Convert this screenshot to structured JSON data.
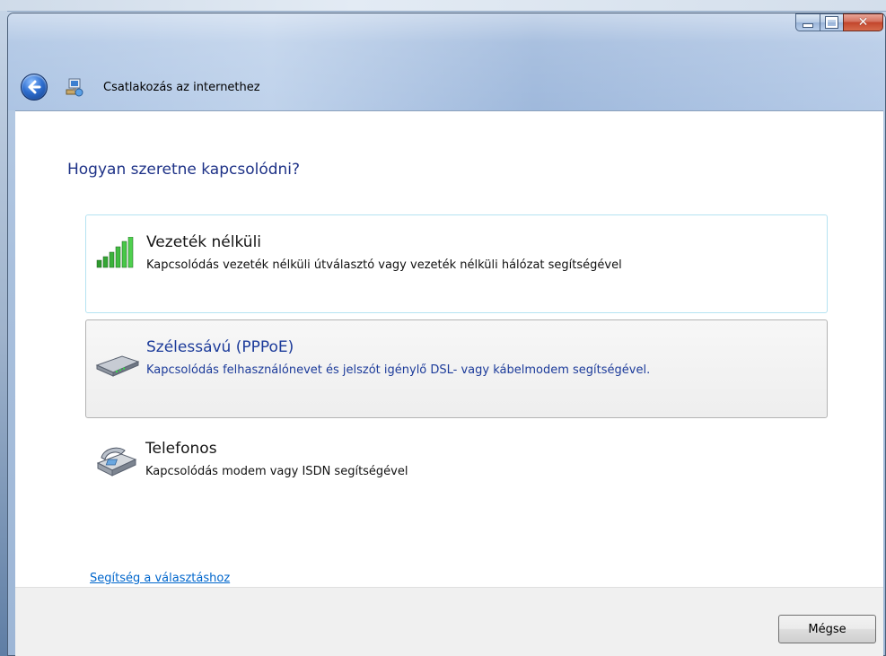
{
  "window": {
    "title": "Csatlakozás az internethez",
    "controls": {
      "minimize_icon": "minimize-icon",
      "maximize_icon": "maximize-icon",
      "close_icon": "close-icon"
    }
  },
  "heading": "Hogyan szeretne kapcsolódni?",
  "options": [
    {
      "title": "Vezeték nélküli",
      "description": "Kapcsolódás vezeték nélküli útválasztó vagy vezeték nélküli hálózat segítségével",
      "icon": "wireless-signal-icon"
    },
    {
      "title": "Szélessávú (PPPoE)",
      "description": "Kapcsolódás felhasználónevet és jelszót igénylő DSL- vagy kábelmodem segítségével.",
      "icon": "broadband-modem-icon"
    },
    {
      "title": "Telefonos",
      "description": "Kapcsolódás modem vagy ISDN segítségével",
      "icon": "dialup-phone-icon"
    }
  ],
  "help_link": "Segítség a választáshoz",
  "buttons": {
    "cancel": "Mégse"
  },
  "colors": {
    "heading": "#1e3287",
    "link": "#0066cc",
    "hover_border": "#b5e3f2",
    "selected_border": "#b3b3b3"
  }
}
